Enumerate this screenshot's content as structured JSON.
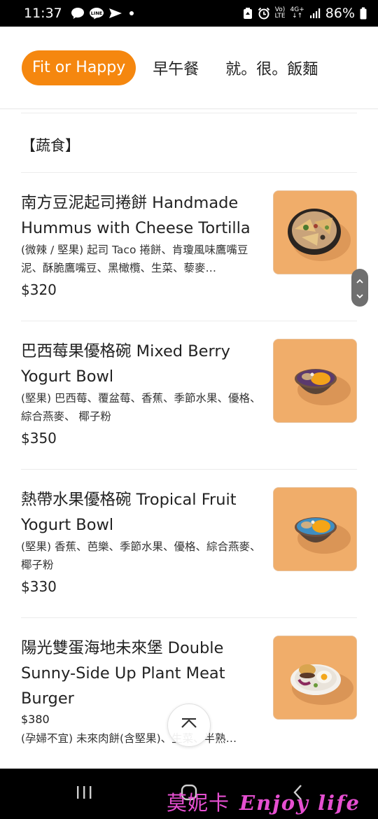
{
  "status_bar": {
    "time": "11:37",
    "network_top": "Vo)",
    "network_bottom": "LTE",
    "signal_top": "4G+",
    "battery": "86%"
  },
  "tabs": [
    {
      "label": "Fit or Happy",
      "active": true
    },
    {
      "label": "早午餐",
      "active": false
    },
    {
      "label": "就。很。飯麵",
      "active": false
    }
  ],
  "section": {
    "title": "【蔬食】"
  },
  "items": [
    {
      "name": "南方豆泥起司捲餅 Handmade Hummus with Cheese Tortilla",
      "description": "(微辣 / 堅果) 起司 Taco 捲餅、肯瓊風味鷹嘴豆泥、酥脆鷹嘴豆、黑橄欖、生菜、藜麥…",
      "price": "$320",
      "photo": "tortilla-bowl-photo"
    },
    {
      "name": "巴西莓果優格碗 Mixed Berry Yogurt Bowl",
      "description": "(堅果) 巴西莓、覆盆莓、香蕉、季節水果、優格、綜合燕麥、 椰子粉",
      "price": "$350",
      "photo": "berry-bowl-photo"
    },
    {
      "name": "熱帶水果優格碗 Tropical Fruit Yogurt Bowl",
      "description": "(堅果) 香蕉、芭樂、季節水果、優格、綜合燕麥、 椰子粉",
      "price": "$330",
      "photo": "tropical-bowl-photo"
    },
    {
      "name": "陽光雙蛋海地未來堡 Double Sunny-Side Up Plant Meat Burger",
      "description": "(孕婦不宜) 未來肉餅(含堅果)、生菜、半熟…",
      "price": "$380",
      "photo": "burger-plate-photo"
    }
  ],
  "watermark": {
    "cjk": "莫妮卡",
    "latin": "Enjoy life"
  },
  "colors": {
    "accent": "#f5870f",
    "photo_bg": "#f0ad6a",
    "watermark": "#e64fd1"
  }
}
